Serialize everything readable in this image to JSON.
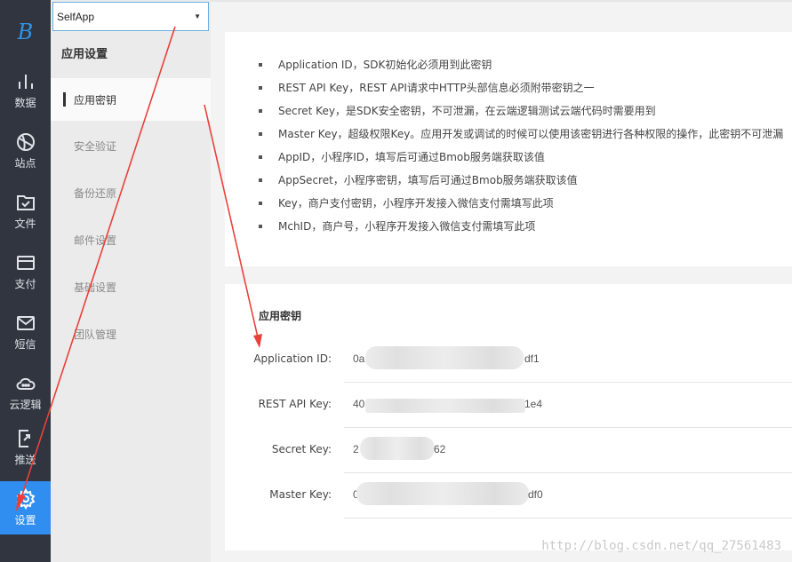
{
  "nav": {
    "logo": "B",
    "items": [
      {
        "label": "数据",
        "icon": "bar-chart-icon"
      },
      {
        "label": "站点",
        "icon": "globe-icon"
      },
      {
        "label": "文件",
        "icon": "folder-check-icon"
      },
      {
        "label": "支付",
        "icon": "credit-card-icon"
      },
      {
        "label": "短信",
        "icon": "mail-icon"
      },
      {
        "label": "云逻辑",
        "icon": "cloud-icon"
      },
      {
        "label": "推送",
        "icon": "push-icon"
      },
      {
        "label": "设置",
        "icon": "gear-icon"
      }
    ]
  },
  "sidebar": {
    "app_select": "SelfApp",
    "title": "应用设置",
    "items": [
      {
        "label": "应用密钥"
      },
      {
        "label": "安全验证"
      },
      {
        "label": "备份还原"
      },
      {
        "label": "邮件设置"
      },
      {
        "label": "基础设置"
      },
      {
        "label": "团队管理"
      }
    ]
  },
  "info": {
    "bullets": [
      "Application ID，SDK初始化必须用到此密钥",
      "REST API Key，REST API请求中HTTP头部信息必须附带密钥之一",
      "Secret Key，是SDK安全密钥，不可泄漏，在云端逻辑测试云端代码时需要用到",
      "Master Key，超级权限Key。应用开发或调试的时候可以使用该密钥进行各种权限的操作，此密钥不可泄漏",
      "AppID，小程序ID，填写后可通过Bmob服务端获取该值",
      "AppSecret，小程序密钥，填写后可通过Bmob服务端获取该值",
      "Key，商户支付密钥，小程序开发接入微信支付需填写此项",
      "MchID，商户号，小程序开发接入微信支付需填写此项"
    ]
  },
  "keys": {
    "title": "应用密钥",
    "rows": [
      {
        "label": "Application ID:",
        "prefix": "0a",
        "suffix": "df1"
      },
      {
        "label": "REST API Key:",
        "prefix": "40",
        "suffix": "1e4"
      },
      {
        "label": "Secret Key:",
        "prefix": "2",
        "suffix": "62"
      },
      {
        "label": "Master Key:",
        "prefix": "0",
        "suffix": "df0"
      }
    ]
  },
  "watermark": "http://blog.csdn.net/qq_27561483",
  "colors": {
    "nav_bg": "#303540",
    "accent": "#2f8ef0",
    "annotation": "#e8413b"
  }
}
